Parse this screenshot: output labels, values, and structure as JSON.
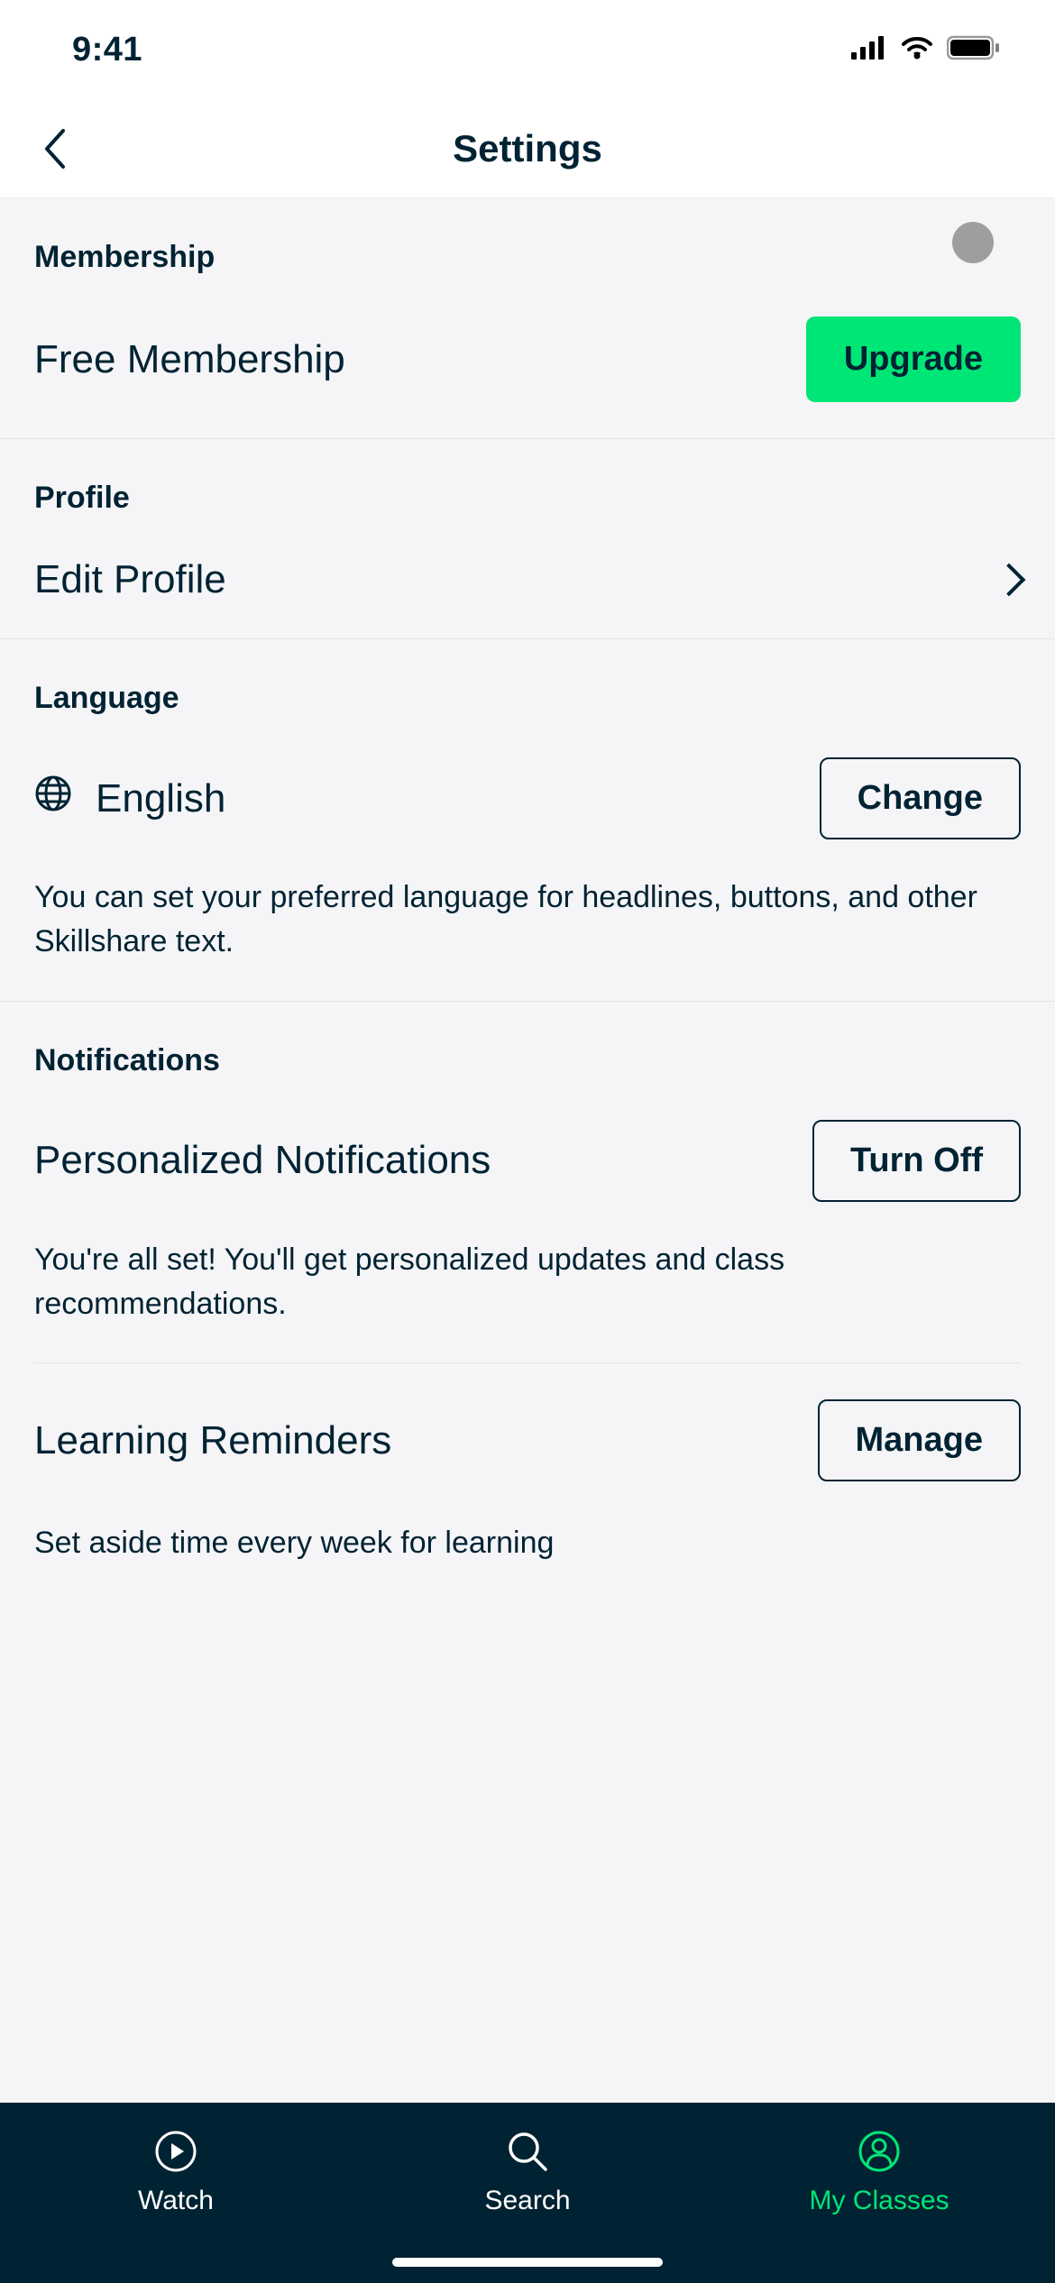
{
  "status": {
    "time": "9:41"
  },
  "header": {
    "title": "Settings"
  },
  "membership": {
    "section_label": "Membership",
    "status_text": "Free Membership",
    "upgrade_label": "Upgrade"
  },
  "profile": {
    "section_label": "Profile",
    "edit_label": "Edit Profile"
  },
  "language": {
    "section_label": "Language",
    "current": "English",
    "change_label": "Change",
    "description": "You can set your preferred language for headlines, buttons, and other Skillshare text."
  },
  "notifications": {
    "section_label": "Notifications",
    "personalized_label": "Personalized Notifications",
    "personalized_button": "Turn Off",
    "personalized_desc": "You're all set! You'll get personalized updates and class recommendations.",
    "reminders_label": "Learning Reminders",
    "reminders_button": "Manage",
    "reminders_desc_partial": "Set aside time every week for learning"
  },
  "tabs": {
    "watch": "Watch",
    "search": "Search",
    "my_classes": "My Classes"
  }
}
